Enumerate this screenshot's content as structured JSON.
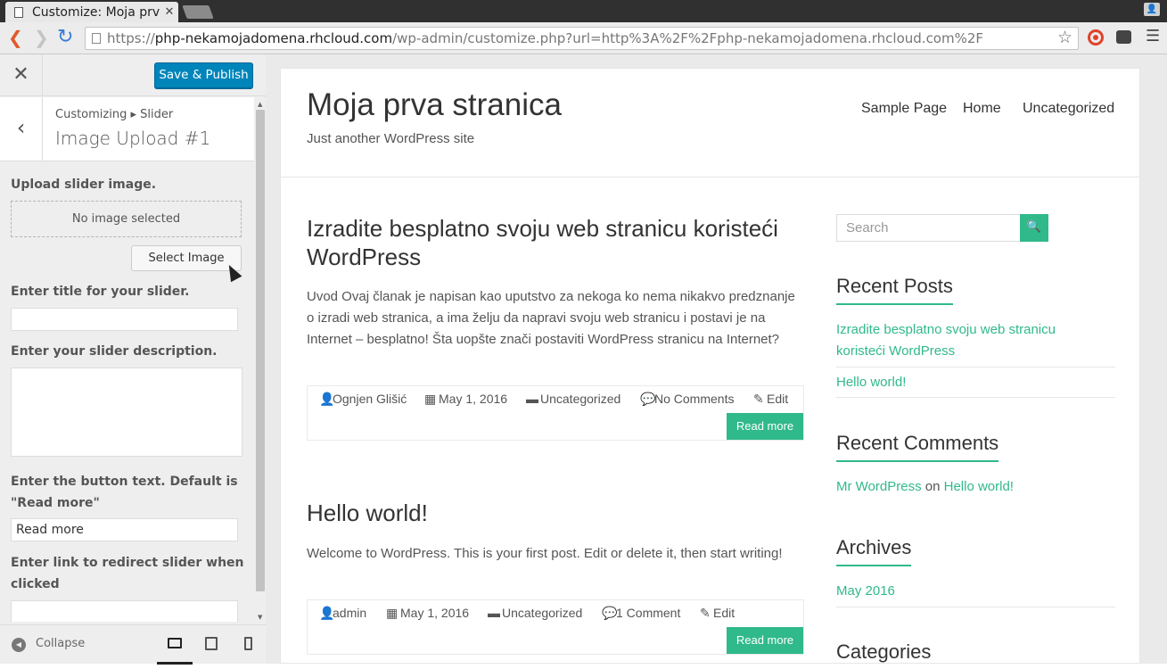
{
  "browser": {
    "tab_title": "Customize: Moja prva",
    "url_prefix": "https://",
    "url_domain": "php-nekamojadomena.rhcloud.com",
    "url_path": "/wp-admin/customize.php?url=http%3A%2F%2Fphp-nekamojadomena.rhcloud.com%2F"
  },
  "customizer": {
    "save_label": "Save & Publish",
    "breadcrumb": "Customizing ▸ Slider",
    "section_title": "Image Upload #1",
    "upload_label": "Upload slider image.",
    "no_image": "No image selected",
    "select_image": "Select Image",
    "title_label": "Enter title for your slider.",
    "title_value": "",
    "desc_label": "Enter your slider description.",
    "button_label": "Enter the button text. Default is \"Read more\"",
    "button_value": "Read more",
    "link_label": "Enter link to redirect slider when clicked",
    "link_value": "",
    "collapse": "Collapse"
  },
  "site": {
    "title": "Moja prva stranica",
    "tagline": "Just another WordPress site",
    "menu": [
      "Sample Page",
      "Home",
      "Uncategorized"
    ]
  },
  "posts": [
    {
      "title": "Izradite besplatno svoju web stranicu koristeći WordPress",
      "excerpt": "Uvod Ovaj članak je napisan kao uputstvo za nekoga ko nema nikakvo predznanje o izradi web stranica, a ima želju da napravi svoju web stranicu i postavi je na Internet – besplatno! Šta uopšte znači postaviti WordPress stranicu na Internet?",
      "author": "Ognjen Glišić",
      "date": "May 1, 2016",
      "category": "Uncategorized",
      "comments": "No Comments",
      "edit": "Edit",
      "read_more": "Read more"
    },
    {
      "title": "Hello world!",
      "excerpt": "Welcome to WordPress. This is your first post. Edit or delete it, then start writing!",
      "author": "admin",
      "date": "May 1, 2016",
      "category": "Uncategorized",
      "comments": "1 Comment",
      "edit": "Edit",
      "read_more": "Read more"
    }
  ],
  "sidebar": {
    "search_placeholder": "Search",
    "recent_posts_title": "Recent Posts",
    "recent_posts": [
      "Izradite besplatno svoju web stranicu koristeći WordPress",
      "Hello world!"
    ],
    "recent_comments_title": "Recent Comments",
    "comment_author": "Mr WordPress",
    "comment_on": "on",
    "comment_post": "Hello world!",
    "archives_title": "Archives",
    "archive_month": "May 2016",
    "categories_title": "Categories"
  },
  "colors": {
    "accent": "#30b98b",
    "wp_blue": "#0085ba"
  }
}
